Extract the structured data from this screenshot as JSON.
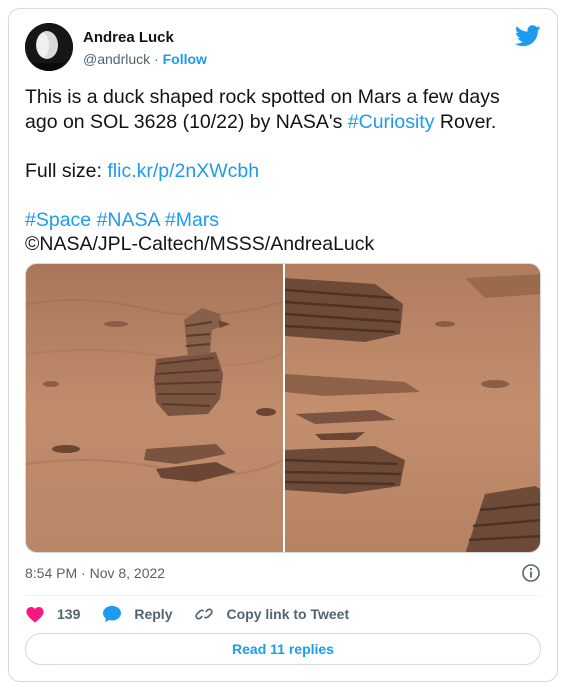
{
  "author": {
    "name": "Andrea Luck",
    "handle": "@andrluck",
    "separator": " · ",
    "follow_label": "Follow"
  },
  "tweet": {
    "line1": "This is a duck shaped rock spotted on Mars a few days",
    "line2_pre": "ago on SOL 3628 (10/22) by NASA's ",
    "line2_tag": "#Curiosity",
    "line2_post": " Rover.",
    "fullsize_label": "Full size: ",
    "fullsize_link": "flic.kr/p/2nXWcbh",
    "tags": [
      "#Space",
      "#NASA",
      "#Mars"
    ],
    "credit": "©NASA/JPL-Caltech/MSSS/AndreaLuck"
  },
  "timestamp": "8:54 PM · Nov 8, 2022",
  "actions": {
    "likes": "139",
    "reply_label": "Reply",
    "copy_label": "Copy link to Tweet"
  },
  "read_replies_label": "Read 11 replies",
  "icons": {
    "brand": "twitter-bird-icon",
    "like": "heart-icon",
    "reply": "speech-bubble-icon",
    "copy": "link-icon",
    "info": "info-icon"
  },
  "colors": {
    "accent": "#1d9bf0",
    "like": "#f91880",
    "text": "#0f1419",
    "muted": "#536471"
  }
}
